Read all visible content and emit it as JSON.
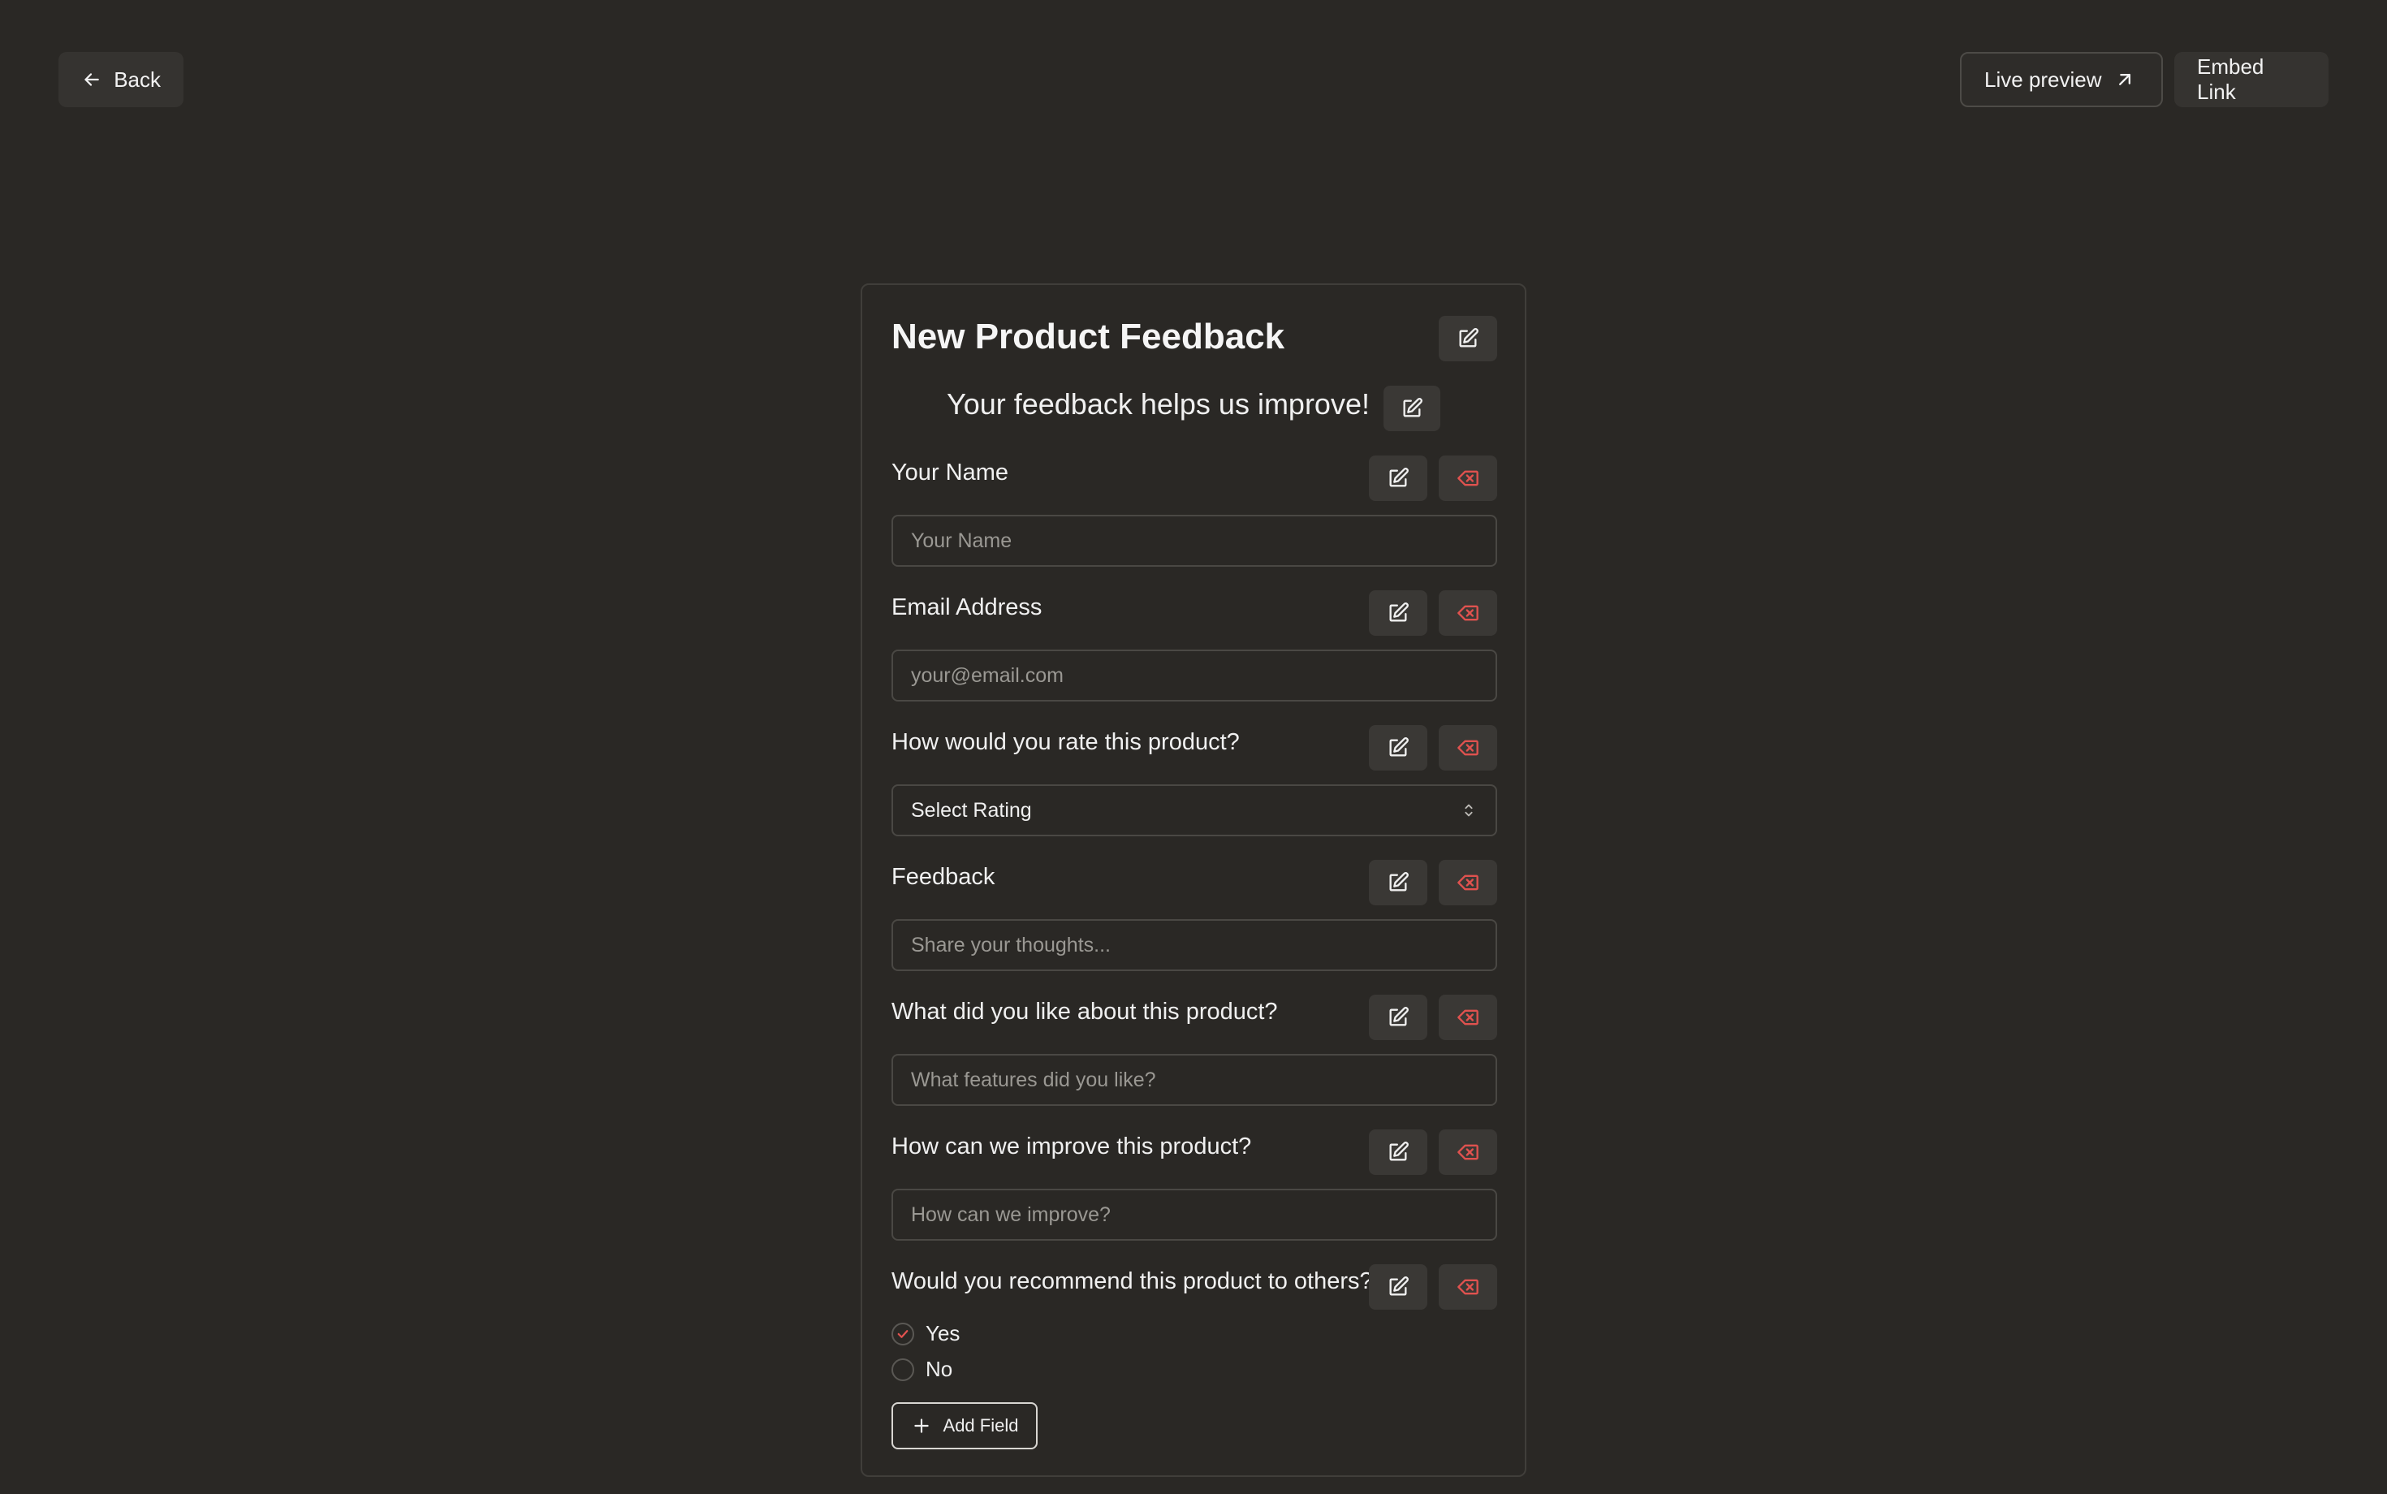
{
  "header": {
    "back_label": "Back",
    "live_preview_label": "Live preview",
    "embed_label": "Embed Link"
  },
  "form": {
    "title": "New Product Feedback",
    "subtitle": "Your feedback helps us improve!",
    "fields": [
      {
        "label": "Your Name",
        "type": "text",
        "placeholder": "Your Name"
      },
      {
        "label": "Email Address",
        "type": "email",
        "placeholder": "your@email.com"
      },
      {
        "label": "How would you rate this product?",
        "type": "select",
        "value": "Select Rating"
      },
      {
        "label": "Feedback",
        "type": "text",
        "placeholder": "Share your thoughts..."
      },
      {
        "label": "What did you like about this product?",
        "type": "text",
        "placeholder": "What features did you like?"
      },
      {
        "label": "How can we improve this product?",
        "type": "text",
        "placeholder": "How can we improve?"
      },
      {
        "label": "Would you recommend this product to others?",
        "type": "radio",
        "options": [
          {
            "label": "Yes",
            "checked": true
          },
          {
            "label": "No",
            "checked": false
          }
        ]
      }
    ],
    "add_field_label": "Add Field"
  },
  "colors": {
    "background": "#2a2825",
    "delete_icon": "#e0524f",
    "check_mark": "#e0524f"
  },
  "icons": {
    "back": "arrow-left-icon",
    "live_preview": "arrow-up-right-icon",
    "edit": "edit-icon",
    "delete": "backspace-icon",
    "select": "chevron-up-down-icon",
    "add": "plus-icon"
  }
}
